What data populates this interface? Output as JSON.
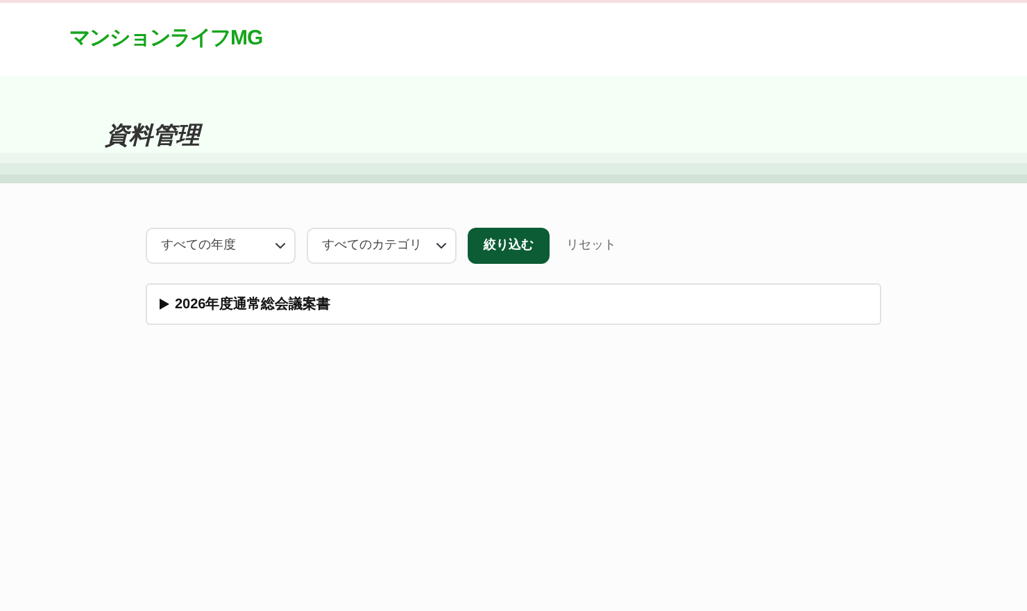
{
  "header": {
    "logo": "マンションライフMG"
  },
  "hero": {
    "title": "資料管理"
  },
  "filters": {
    "year_select": "すべての年度",
    "category_select": "すべてのカテゴリ",
    "submit_button": "絞り込む",
    "reset_link": "リセット"
  },
  "documents": [
    {
      "title": "2026年度通常総会議案書",
      "expanded": false
    }
  ]
}
